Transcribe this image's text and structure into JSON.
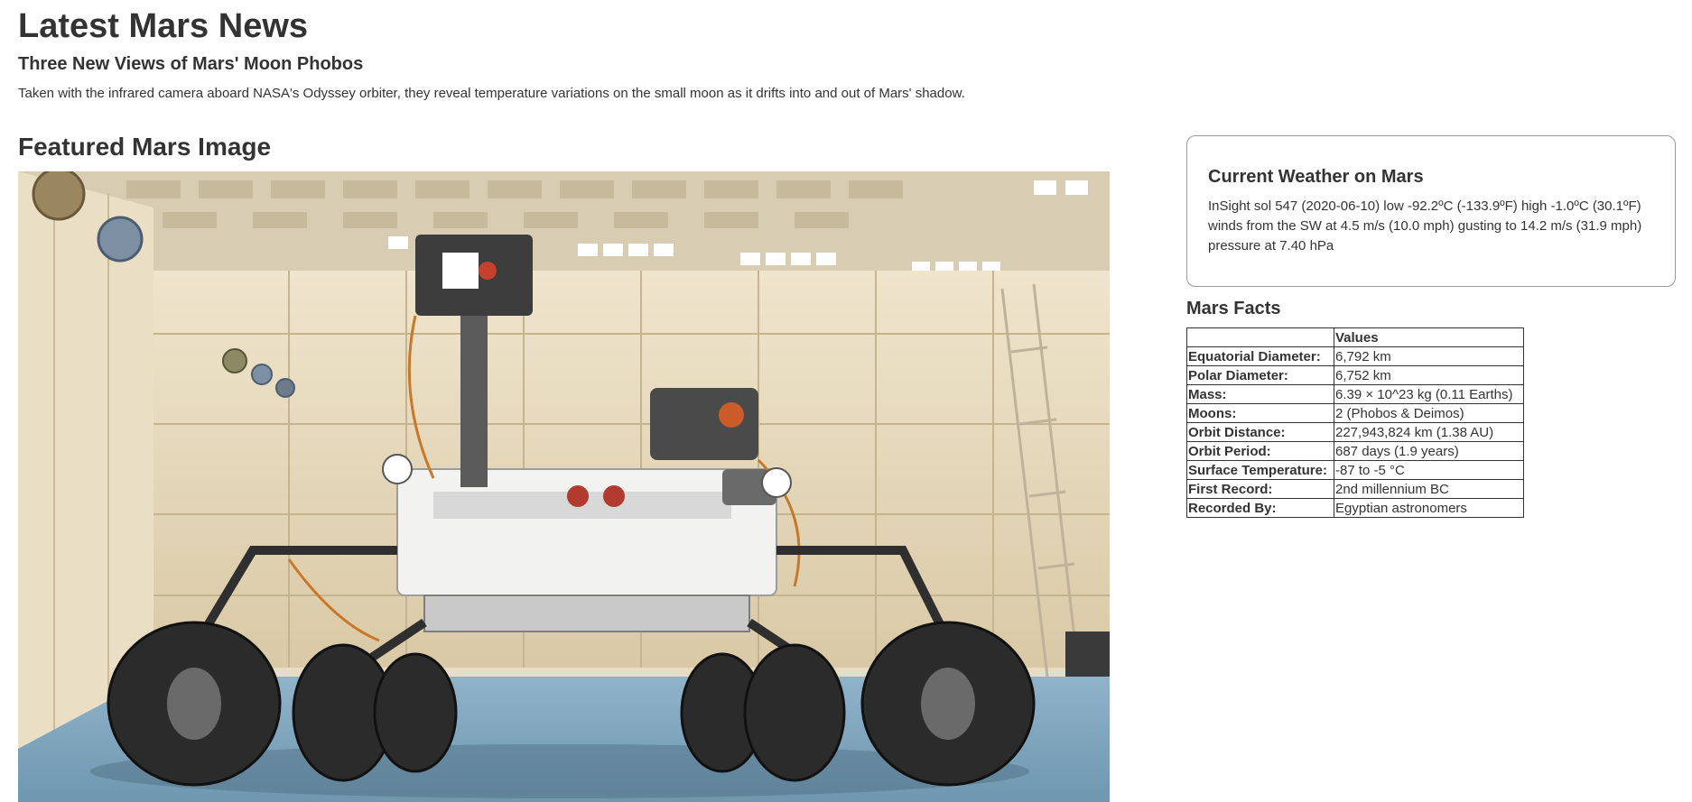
{
  "news": {
    "section_title": "Latest Mars News",
    "headline": "Three New Views of Mars' Moon Phobos",
    "paragraph": "Taken with the infrared camera aboard NASA's Odyssey orbiter, they reveal temperature variations on the small moon as it drifts into and out of Mars' shadow."
  },
  "featured": {
    "section_title": "Featured Mars Image",
    "image_alt": "Mars rover in clean room"
  },
  "weather": {
    "title": "Current Weather on Mars",
    "report": "InSight sol 547 (2020-06-10) low -92.2ºC (-133.9ºF) high -1.0ºC (30.1ºF) winds from the SW at 4.5 m/s (10.0 mph) gusting to 14.2 m/s (31.9 mph) pressure at 7.40 hPa"
  },
  "facts": {
    "title": "Mars Facts",
    "header": [
      "",
      "Values"
    ],
    "rows": [
      {
        "label": "Equatorial Diameter:",
        "value": "6,792 km"
      },
      {
        "label": "Polar Diameter:",
        "value": "6,752 km"
      },
      {
        "label": "Mass:",
        "value": "6.39 × 10^23 kg (0.11 Earths)"
      },
      {
        "label": "Moons:",
        "value": "2 (Phobos & Deimos)"
      },
      {
        "label": "Orbit Distance:",
        "value": "227,943,824 km (1.38 AU)"
      },
      {
        "label": "Orbit Period:",
        "value": "687 days (1.9 years)"
      },
      {
        "label": "Surface Temperature:",
        "value": "-87 to -5 °C"
      },
      {
        "label": "First Record:",
        "value": "2nd millennium BC"
      },
      {
        "label": "Recorded By:",
        "value": "Egyptian astronomers"
      }
    ]
  }
}
